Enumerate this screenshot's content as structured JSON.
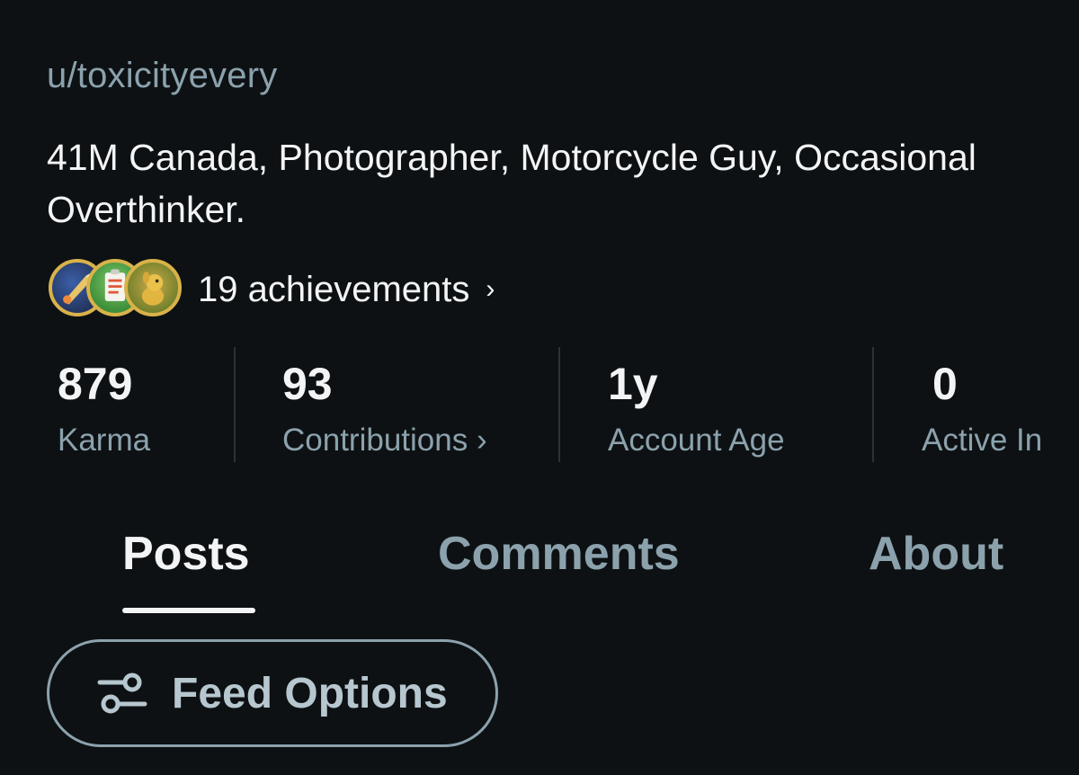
{
  "profile": {
    "username": "u/toxicityevery",
    "bio": "41M Canada, Photographer, Motorcycle Guy, Occasional Overthinker."
  },
  "achievements": {
    "label": "19 achievements",
    "chevron": "›",
    "badges": [
      "achievement-badge-icon",
      "achievement-badge-icon",
      "achievement-badge-icon"
    ]
  },
  "stats": [
    {
      "value": "879",
      "label": "Karma"
    },
    {
      "value": "93",
      "label": "Contributions ›"
    },
    {
      "value": "1y",
      "label": "Account Age"
    },
    {
      "value": "0",
      "label": "Active In"
    }
  ],
  "tabs": [
    {
      "label": "Posts",
      "active": true
    },
    {
      "label": "Comments",
      "active": false
    },
    {
      "label": "About",
      "active": false
    }
  ],
  "feed_options": {
    "label": "Feed Options",
    "icon": "sliders-icon"
  },
  "colors": {
    "background": "#0e1113",
    "muted_text": "#8ba2ad",
    "primary_text": "#f2f4f5",
    "badge_border": "#d9b24a"
  }
}
